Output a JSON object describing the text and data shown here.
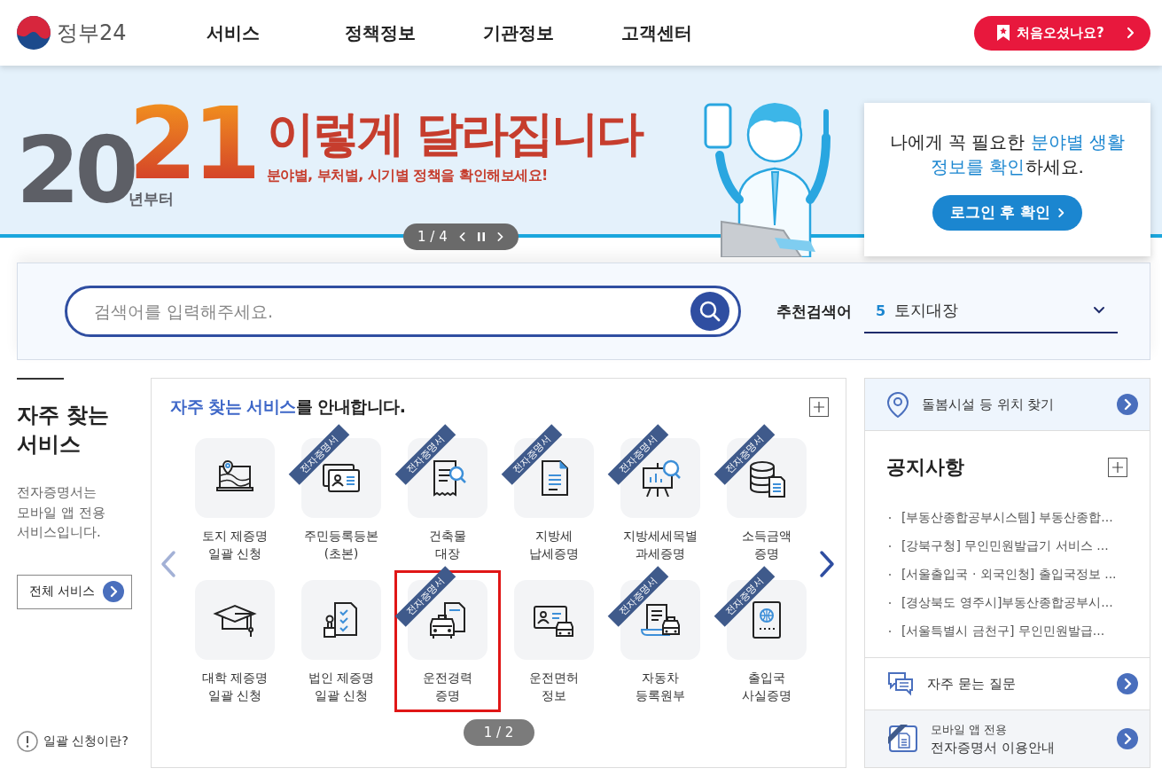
{
  "header": {
    "logo": "정부24",
    "nav": [
      {
        "label": "서비스"
      },
      {
        "label": "정책정보"
      },
      {
        "label": "기관정보"
      },
      {
        "label": "고객센터"
      }
    ],
    "first_visit_button": "처음오셨나요?"
  },
  "banner": {
    "year_prefix": "20",
    "year_suffix": "21",
    "since": "년부터",
    "headline": "이렇게 달라집니다",
    "subtitle": "분야별, 부처별, 시기별 정책을 확인해보세요!",
    "pager": "1 / 4"
  },
  "login_card": {
    "message": [
      {
        "text": "나에게 꼭 필요한 ",
        "accent": false
      },
      {
        "text": "분야별 생활 정보를 확인",
        "accent": true
      },
      {
        "text": "하세요.",
        "accent": false
      }
    ],
    "button": "로그인 후 확인"
  },
  "search": {
    "placeholder": "검색어를 입력해주세요.",
    "recommended_label": "추천검색어",
    "recommended_rank": "5",
    "recommended_term": "토지대장"
  },
  "intro": {
    "title": "자주 찾는 서비스",
    "description": "전자증명서는 모바일 앱 전용 서비스입니다.",
    "all_services_button": "전체 서비스",
    "help_link": "일괄 신청이란?"
  },
  "services": {
    "title": [
      {
        "text": "자주 찾는 서비스",
        "accent": true
      },
      {
        "text": "를 안내합니다.",
        "accent": false
      }
    ],
    "pager": "1 / 2",
    "items": [
      {
        "label": "토지 제증명\n일괄 신청",
        "highlighted": false
      },
      {
        "label": "주민등록등본\n(초본)",
        "badge": "전자증명서",
        "highlighted": false
      },
      {
        "label": "건축물\n대장",
        "badge": "전자증명서",
        "highlighted": false
      },
      {
        "label": "지방세\n납세증명",
        "badge": "전자증명서",
        "highlighted": false
      },
      {
        "label": "지방세세목별\n과세증명",
        "badge": "전자증명서",
        "highlighted": false
      },
      {
        "label": "소득금액\n증명",
        "badge": "전자증명서",
        "highlighted": false
      },
      {
        "label": "대학 제증명\n일괄 신청",
        "highlighted": false
      },
      {
        "label": "법인 제증명\n일괄 신청",
        "highlighted": false
      },
      {
        "label": "운전경력\n증명",
        "badge": "전자증명서",
        "highlighted": true
      },
      {
        "label": "운전면허\n정보",
        "highlighted": false
      },
      {
        "label": "자동차\n등록원부",
        "badge": "전자증명서",
        "highlighted": false
      },
      {
        "label": "출입국\n사실증명",
        "badge": "전자증명서",
        "highlighted": false
      }
    ]
  },
  "side": {
    "location_link": "돌봄시설 등 위치 찾기",
    "notices_title": "공지사항",
    "notices": [
      "[부동산종합공부시스템] 부동산종합...",
      "[강북구청] 무인민원발급기 서비스 ...",
      "[서울출입국 · 외국인청] 출입국정보 ...",
      "[경상북도 영주시]부동산종합공부시...",
      "[서울특별시 금천구] 무인민원발급..."
    ],
    "faq_link": "자주 묻는 질문",
    "mobile_line1": "모바일 앱 전용",
    "mobile_line2": "전자증명서 이용안내"
  }
}
